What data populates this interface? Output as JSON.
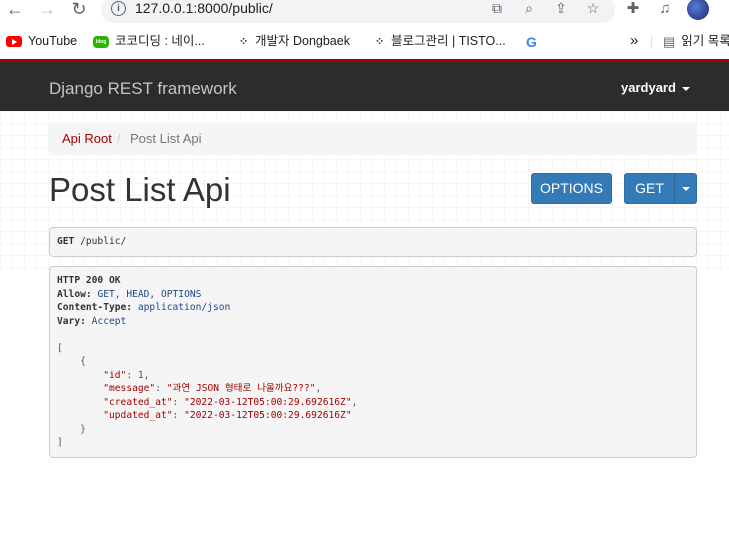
{
  "browser": {
    "url": "127.0.0.1:8000/public/",
    "bookmarks": [
      {
        "label": "YouTube",
        "icon": "youtube-icon"
      },
      {
        "label": "코코디딩 : 네이...",
        "icon": "naver-blog-icon"
      },
      {
        "label": "개발자 Dongbaek",
        "icon": "tistory-icon"
      },
      {
        "label": "블로그관리 | TISTO...",
        "icon": "tistory-icon"
      },
      {
        "label": "G",
        "icon": "google-icon"
      }
    ],
    "more_label": "»",
    "reading_list_label": "읽기 목록"
  },
  "navbar": {
    "brand": "Django REST framework",
    "user": "yardyard"
  },
  "breadcrumb": {
    "root": "Api Root",
    "separator": "/",
    "current": "Post List Api"
  },
  "page": {
    "title": "Post List Api",
    "options_label": "OPTIONS",
    "get_label": "GET"
  },
  "request": {
    "method": "GET",
    "path": "/public/"
  },
  "response": {
    "status": "HTTP 200 OK",
    "allow_key": "Allow:",
    "allow_value": "GET, HEAD, OPTIONS",
    "content_type_key": "Content-Type:",
    "content_type_value": "application/json",
    "vary_key": "Vary:",
    "vary_value": "Accept",
    "body": {
      "open_bracket": "[",
      "open_brace": "{",
      "id_key": "\"id\"",
      "id_value": "1",
      "message_key": "\"message\"",
      "message_value": "\"과연 JSON 형태로 나올까요???\"",
      "created_key": "\"created_at\"",
      "created_value": "\"2022-03-12T05:00:29.692616Z\"",
      "updated_key": "\"updated_at\"",
      "updated_value": "\"2022-03-12T05:00:29.692616Z\"",
      "close_brace": "}",
      "close_bracket": "]"
    }
  },
  "colors": {
    "navbar_bg": "#2c2c2c",
    "accent_red": "#a30000",
    "button_blue": "#337ab7"
  }
}
